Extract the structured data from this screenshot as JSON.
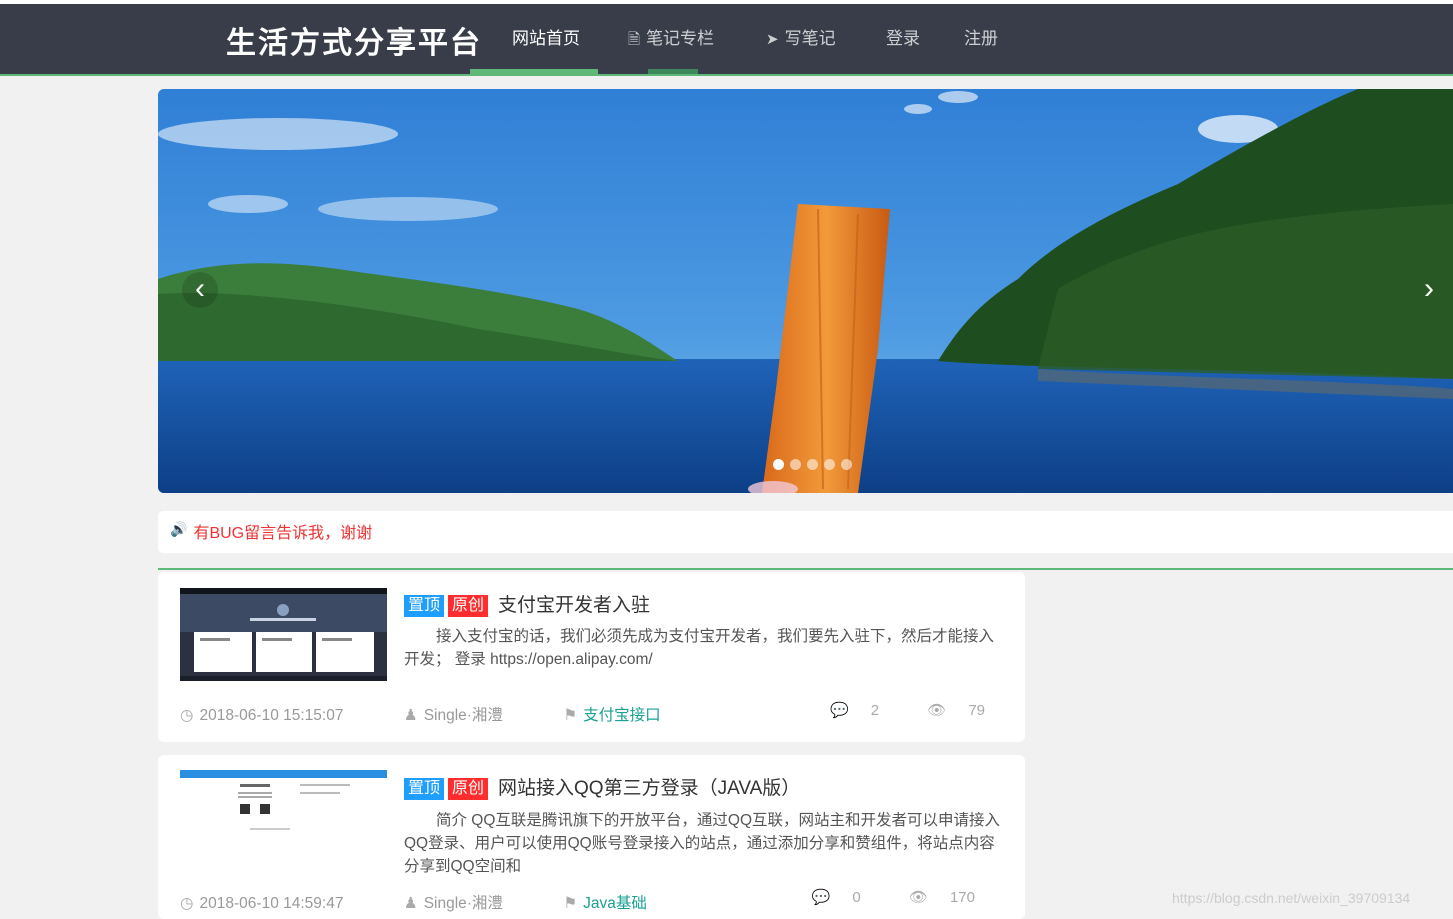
{
  "header": {
    "brand": "生活方式分享平台",
    "nav": [
      {
        "label": "网站首页",
        "icon": "home-icon",
        "active": true
      },
      {
        "label": "笔记专栏",
        "icon": "document-icon",
        "active": false
      },
      {
        "label": "写笔记",
        "icon": "paper-plane-icon",
        "active": false
      },
      {
        "label": "登录",
        "icon": "",
        "active": false
      },
      {
        "label": "注册",
        "icon": "",
        "active": false
      }
    ]
  },
  "carousel": {
    "prev_icon": "chevron-left-icon",
    "next_icon": "chevron-right-icon",
    "slide_count": 5,
    "active_index": 0
  },
  "notice": {
    "icon": "speaker-icon",
    "text": "有BUG留言告诉我，谢谢"
  },
  "articles": [
    {
      "badge_top": "置顶",
      "badge_original": "原创",
      "title": "支付宝开发者入驻",
      "excerpt": "接入支付宝的话，我们必须先成为支付宝开发者，我们要先入驻下，然后才能接入开发；   登录 https://open.alipay.com/",
      "date": "2018-06-10 15:15:07",
      "author": "Single·湘澧",
      "tag": "支付宝接口",
      "comments": "2",
      "views": "79"
    },
    {
      "badge_top": "置顶",
      "badge_original": "原创",
      "title": "网站接入QQ第三方登录（JAVA版）",
      "excerpt": "简介 QQ互联是腾讯旗下的开放平台，通过QQ互联，网站主和开发者可以申请接入QQ登录、用户可以使用QQ账号登录接入的站点，通过添加分享和赞组件，将站点内容分享到QQ空间和",
      "date": "2018-06-10 14:59:47",
      "author": "Single·湘澧",
      "tag": "Java基础",
      "comments": "0",
      "views": "170"
    }
  ],
  "watermark": "https://blog.csdn.net/weixin_39709134",
  "colors": {
    "navbar": "#393d49",
    "accent_green": "#5fb878",
    "tag_teal": "#1aa094",
    "badge_blue": "#1e9fff",
    "badge_red": "#ff2d2d",
    "notice_red": "#ee3333"
  }
}
